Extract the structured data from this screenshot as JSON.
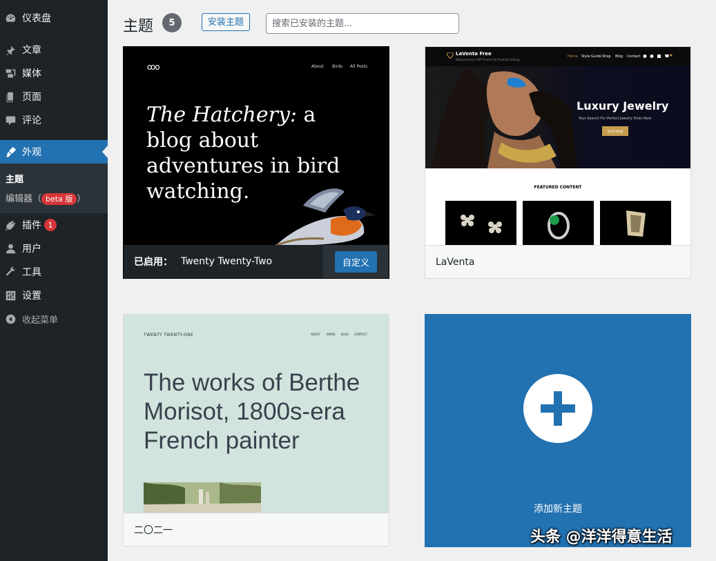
{
  "sidebar": {
    "items": [
      {
        "label": "仪表盘",
        "icon": "dashboard-icon"
      },
      {
        "label": "文章",
        "icon": "pushpin-icon"
      },
      {
        "label": "媒体",
        "icon": "media-icon"
      },
      {
        "label": "页面",
        "icon": "page-icon"
      },
      {
        "label": "评论",
        "icon": "comment-icon"
      },
      {
        "label": "外观",
        "icon": "brush-icon"
      },
      {
        "label": "插件",
        "icon": "plugin-icon",
        "badge": "1"
      },
      {
        "label": "用户",
        "icon": "user-icon"
      },
      {
        "label": "工具",
        "icon": "wrench-icon"
      },
      {
        "label": "设置",
        "icon": "settings-icon"
      },
      {
        "label": "收起菜单",
        "icon": "collapse-icon"
      }
    ],
    "submenu": {
      "themes": "主题",
      "editor_prefix": "编辑器（",
      "editor_badge": "beta 版",
      "editor_suffix": "）"
    }
  },
  "header": {
    "title": "主题",
    "count": "5",
    "install_label": "安装主题",
    "search_placeholder": "搜索已安装的主题..."
  },
  "themes": {
    "tt2": {
      "active_label": "已启用：",
      "name": "Twenty Twenty-Two",
      "customize_label": "自定义",
      "preview": {
        "logo": "ꝏo",
        "nav": [
          "About",
          "Birds",
          "All Posts"
        ],
        "headline_italic": "The Hatchery:",
        "headline_rest": " a blog about adventures in bird watching."
      }
    },
    "laventa": {
      "name": "LaVenta",
      "preview": {
        "brand": "LaVenta Free",
        "tagline": "Woocommerce WP Theme For Portfolio Selling",
        "nav": [
          "Home",
          "Style Guide",
          "Shop",
          "Blog",
          "Contact"
        ],
        "hero_title": "Luxury Jewelry",
        "hero_sub": "Your Search For Perfect Jewelry Ends Here",
        "shop_label": "SHOP NOW",
        "featured": "FEATURED CONTENT"
      }
    },
    "tt1": {
      "name": "二〇二一",
      "preview": {
        "site_title": "TWENTY TWENTY-ONE",
        "nav": [
          "ABOUT",
          "WORK",
          "BLOG",
          "CONTACT"
        ],
        "headline": "The works of Berthe Morisot, 1800s-era French painter"
      }
    },
    "add_new": {
      "label": "添加新主题"
    }
  },
  "watermark": "头条 @洋洋得意生活",
  "colors": {
    "sidebar_bg": "#1d2327",
    "accent": "#2271b1",
    "badge_red": "#d63638"
  }
}
